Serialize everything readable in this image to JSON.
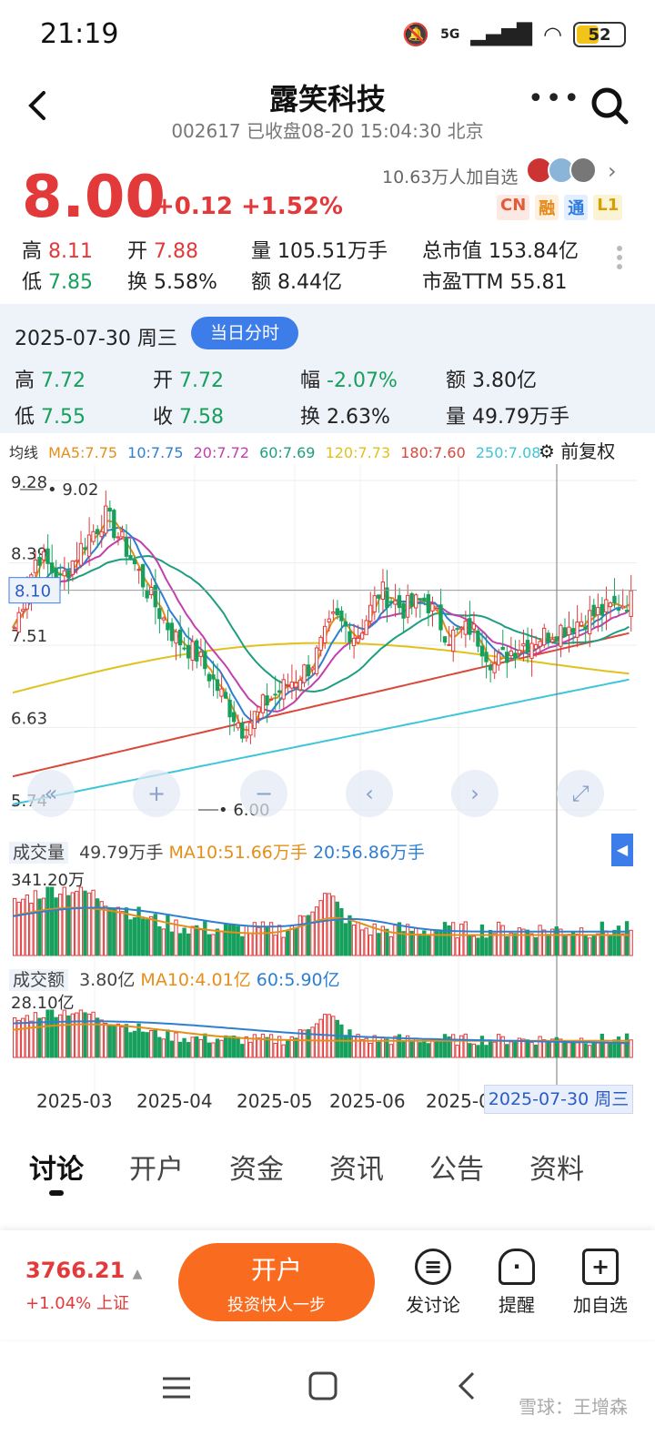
{
  "status": {
    "time": "21:19",
    "network": "5G",
    "battery": "52"
  },
  "header": {
    "title": "露笑科技",
    "subtitle": "002617 已收盘08-20 15:04:30 北京"
  },
  "quote": {
    "price": "8.00",
    "change": "+0.12 +1.52%",
    "followers": "10.63万人加自选",
    "tags": [
      "CN",
      "融",
      "通",
      "L1"
    ],
    "stats": [
      {
        "label": "高",
        "value": "8.11"
      },
      {
        "label": "开",
        "value": "7.88"
      },
      {
        "label": "量",
        "value": "105.51万手"
      },
      {
        "label": "总市值",
        "value": "153.84亿"
      },
      {
        "label": "低",
        "value": "7.85"
      },
      {
        "label": "换",
        "value": "5.58%"
      },
      {
        "label": "额",
        "value": "8.44亿"
      },
      {
        "label": "市盈TTM",
        "value": "55.81"
      }
    ]
  },
  "day": {
    "date": "2025-07-30 周三",
    "button": "当日分时",
    "stats": [
      {
        "label": "高",
        "value": "7.72"
      },
      {
        "label": "开",
        "value": "7.72"
      },
      {
        "label": "幅",
        "value": "-2.07%"
      },
      {
        "label": "额",
        "value": "3.80亿"
      },
      {
        "label": "低",
        "value": "7.55"
      },
      {
        "label": "收",
        "value": "7.58"
      },
      {
        "label": "换",
        "value": "2.63%"
      },
      {
        "label": "量",
        "value": "49.79万手"
      }
    ]
  },
  "ma": {
    "label": "均线",
    "items": [
      {
        "text": "MA5:7.75",
        "color": "#e58f1a"
      },
      {
        "text": "10:7.75",
        "color": "#2f7fd1"
      },
      {
        "text": "20:7.72",
        "color": "#c23fae"
      },
      {
        "text": "60:7.69",
        "color": "#1e9e80"
      },
      {
        "text": "120:7.73",
        "color": "#e0c21d"
      },
      {
        "text": "180:7.60",
        "color": "#d9483b"
      },
      {
        "text": "250:7.08",
        "color": "#3cc6d8"
      }
    ],
    "adjust": "前复权"
  },
  "chart_data": {
    "type": "candlestick",
    "y_ticks": [
      "9.28",
      "8.39",
      "7.51",
      "6.63",
      "5.74"
    ],
    "price_marker": "8.10",
    "high_annotation": "9.02",
    "low_annotation": "6.00",
    "x_ticks": [
      "2025-03",
      "2025-04",
      "2025-05",
      "2025-06",
      "2025-0"
    ],
    "crosshair_date": "2025-07-30 周三",
    "close_path": [
      7.7,
      8.5,
      8.2,
      8.6,
      8.9,
      8.5,
      8.0,
      7.6,
      7.4,
      7.0,
      6.6,
      6.9,
      7.1,
      7.3,
      7.8,
      7.6,
      8.1,
      7.9,
      8.0,
      7.6,
      7.7,
      7.3,
      7.5,
      7.6,
      7.7,
      7.8,
      7.9,
      8.0
    ],
    "volume": {
      "label": "成交量",
      "value": "49.79万手",
      "ma10": "MA10:51.66万手",
      "ma20": "20:56.86万手",
      "max": "341.20万"
    },
    "amount": {
      "label": "成交额",
      "value": "3.80亿",
      "ma10": "MA10:4.01亿",
      "ma60": "60:5.90亿",
      "max": "28.10亿"
    }
  },
  "tabs": [
    "讨论",
    "开户",
    "资金",
    "资讯",
    "公告",
    "资料"
  ],
  "bottom": {
    "index": "3766.21",
    "index_change": "+1.04% 上证",
    "open_title": "开户",
    "open_sub": "投资快人一步",
    "actions": [
      "发讨论",
      "提醒",
      "加自选"
    ]
  },
  "watermark": "雪球：王增森"
}
